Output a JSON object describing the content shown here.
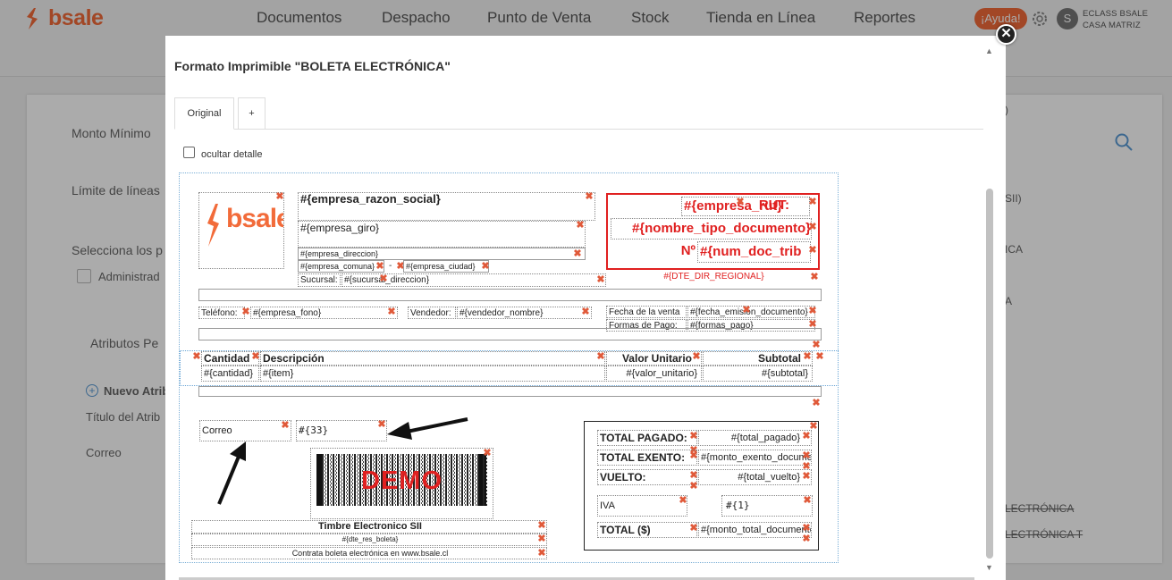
{
  "app": {
    "logo_text": "bsale",
    "nav": [
      "Documentos",
      "Despacho",
      "Punto de Venta",
      "Stock",
      "Tienda en Línea",
      "Reportes"
    ],
    "help_label": "¡Ayuda!",
    "avatar_letter": "S",
    "user_line1": "ECLASS BSALE",
    "user_line2": "CASA MATRIZ",
    "brand_color": "#f26b3a"
  },
  "background": {
    "labels": [
      "Monto Mínimo",
      "Límite de líneas",
      "Selecciona los p",
      "Administrad",
      "Atributos Pe",
      "Nuevo Atrib",
      "Título del Atrib",
      "Correo"
    ],
    "right_labels": [
      ")",
      "SII)",
      "ICA",
      "A",
      "LECTRÓNICA",
      "LECTRÓNICA T"
    ]
  },
  "modal": {
    "title": "Formato Imprimible \"BOLETA ELECTRÓNICA\"",
    "tabs": [
      "Original",
      "+"
    ],
    "hide_detail_label": "ocultar detalle",
    "close_icon": "close-icon"
  },
  "doc": {
    "logo_text": "bsale",
    "razon_social": "#{empresa_razon_social}",
    "giro": "#{empresa_giro}",
    "direccion": "#{empresa_direccion}",
    "comuna": "#{empresa_comuna}",
    "separator_dash": "-",
    "ciudad": "#{empresa_ciudad}",
    "sucursal_label": "Sucursal:",
    "sucursal_value": "#{sucursal_direccion}",
    "rut_label": "RUT:",
    "rut_value": "#{empresa_rut}",
    "tipo_documento": "#{nombre_tipo_documento}",
    "num_label": "Nº",
    "num_value": "#{num_doc_trib",
    "dte_regional": "#{DTE_DIR_REGIONAL}",
    "telefono_label": "Teléfono:",
    "telefono_value": "#{empresa_fono}",
    "vendedor_label": "Vendedor:",
    "vendedor_value": "#{vendedor_nombre}",
    "fecha_label": "Fecha de la venta",
    "fecha_value": "#{fecha_emision_documento}",
    "formas_label": "Formas de Pago:",
    "formas_value": "#{formas_pago}",
    "col_cantidad": "Cantidad",
    "col_descripcion": "Descripción",
    "col_valor": "Valor Unitario",
    "col_subtotal": "Subtotal",
    "row_cantidad": "#{cantidad}",
    "row_item": "#{item}",
    "row_valor": "#{valor_unitario}",
    "row_subtotal": "#{subtotal}",
    "correo_label": "Correo",
    "correo_value": "#{33}",
    "demo_text": "DEMO",
    "timbre_label": "Timbre Electronico SII",
    "res_boleta": "#{dte_res_boleta}",
    "contrata": "Contrata boleta electrónica en www.bsale.cl",
    "total_pagado_label": "TOTAL PAGADO:",
    "total_pagado_value": "#{total_pagado}",
    "total_exento_label": "TOTAL EXENTO:",
    "total_exento_value": "#{monto_exento_documento}",
    "vuelto_label": "VUELTO:",
    "vuelto_value": "#{total_vuelto}",
    "iva_label": "IVA",
    "iva_value": "#{1}",
    "total_label": "TOTAL ($)",
    "total_value": "#{monto_total_documento}",
    "accent_red": "#e02020",
    "delete_icon": "delete-x-icon"
  }
}
